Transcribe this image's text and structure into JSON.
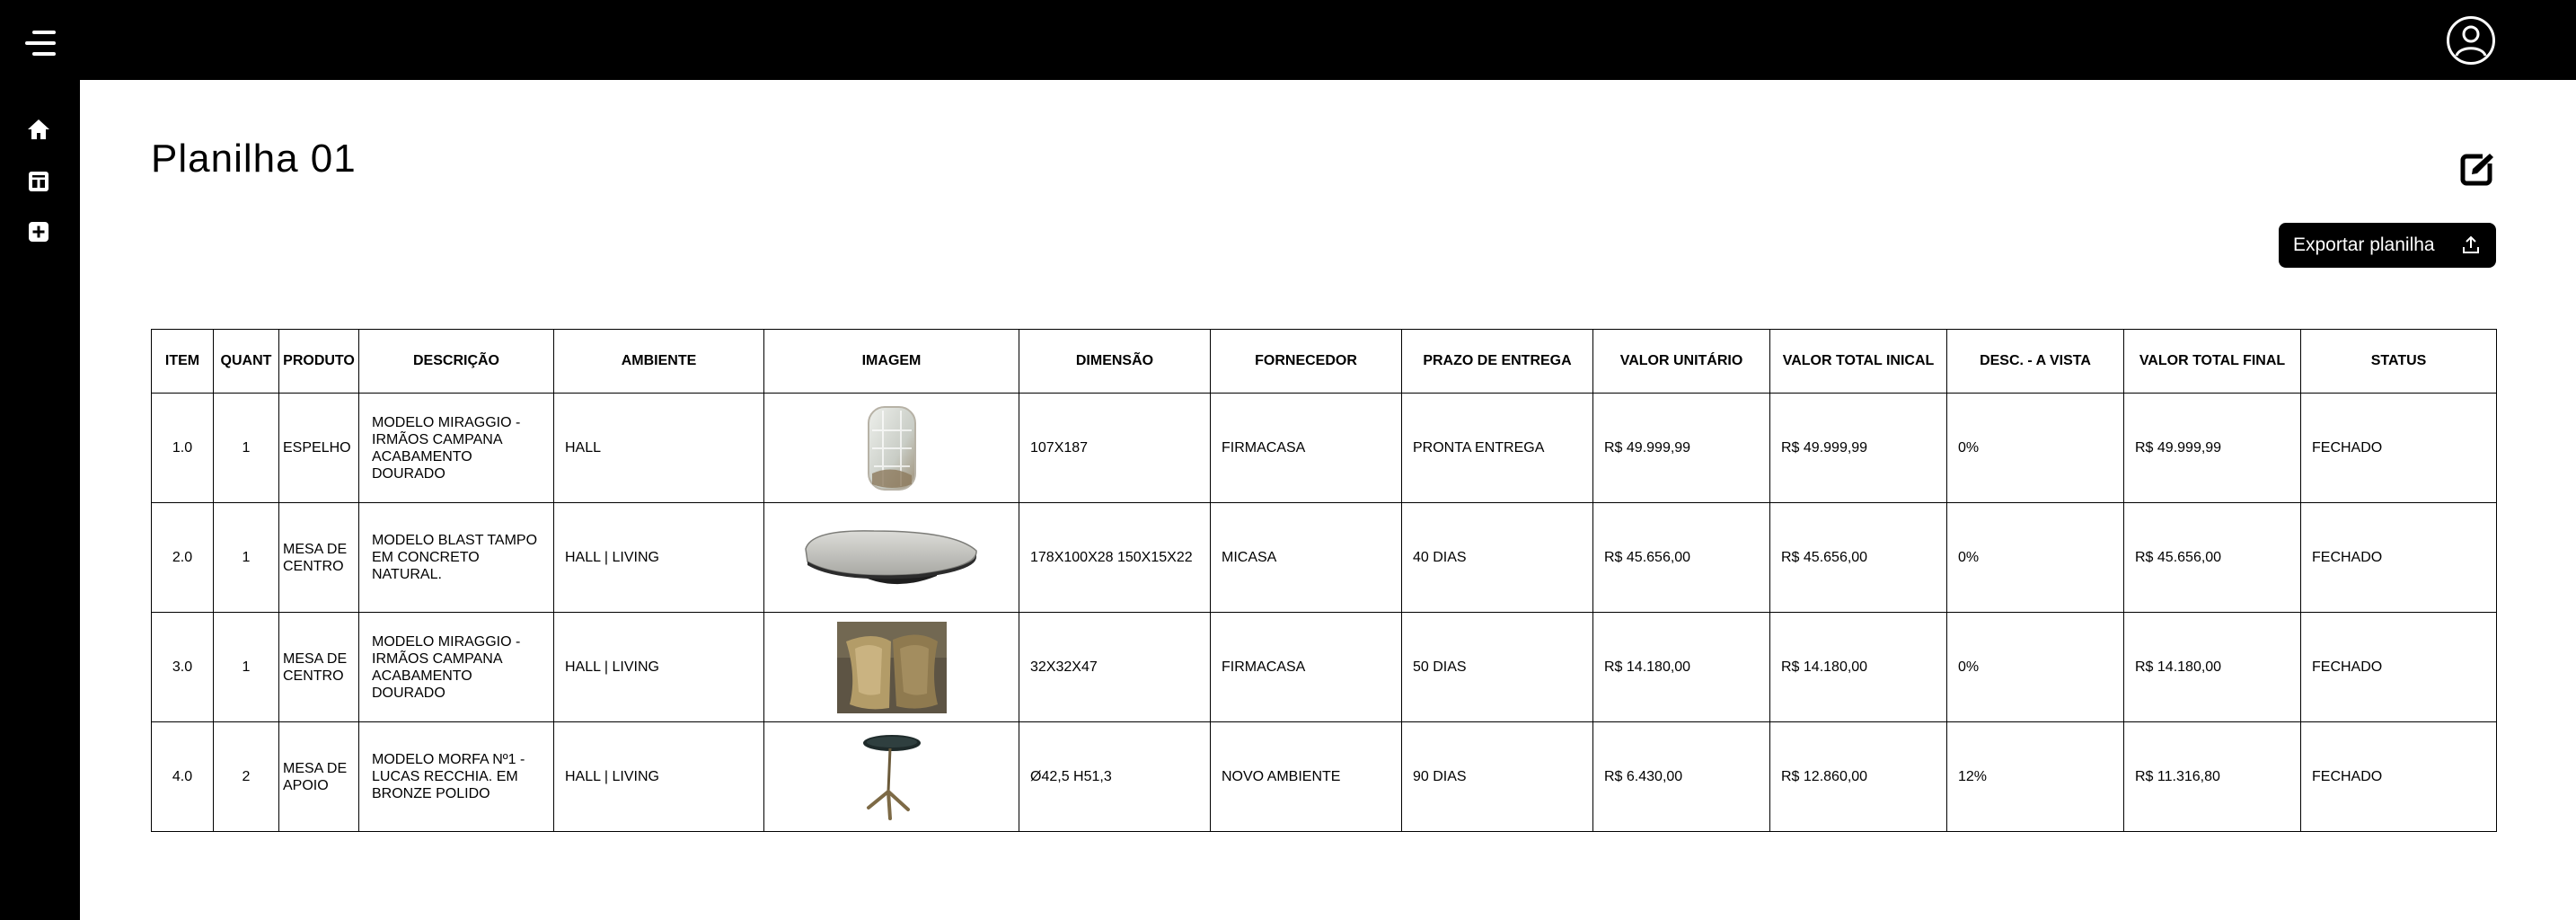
{
  "page": {
    "title": "Planilha 01",
    "export_label": "Exportar planilha"
  },
  "icons": {
    "menu": "menu-icon",
    "user": "user-avatar-icon",
    "home": "home-icon",
    "spreadsheet": "spreadsheet-icon",
    "add": "add-icon",
    "edit": "edit-icon",
    "upload": "upload-icon"
  },
  "colors": {
    "bar": "#000000",
    "background": "#ffffff",
    "text": "#000000"
  },
  "table": {
    "headers": [
      "ITEM",
      "QUANT",
      "PRODUTO",
      "DESCRIÇÃO",
      "AMBIENTE",
      "IMAGEM",
      "DIMENSÃO",
      "FORNECEDOR",
      "PRAZO DE ENTREGA",
      "VALOR UNITÁRIO",
      "VALOR TOTAL INICAL",
      "DESC. - A VISTA",
      "VALOR TOTAL FINAL",
      "STATUS"
    ],
    "rows": [
      {
        "item": "1.0",
        "quant": "1",
        "produto": "ESPELHO",
        "descricao": "MODELO MIRAGGIO - IRMÃOS CAMPANA ACABAMENTO DOURADO",
        "ambiente": "HALL",
        "imagem": "mirror-image",
        "dimensao": "107X187",
        "fornecedor": "FIRMACASA",
        "prazo": "PRONTA ENTREGA",
        "valor_unitario": "R$ 49.999,99",
        "valor_total_inicial": "R$ 49.999,99",
        "desconto": "0%",
        "valor_total_final": "R$ 49.999,99",
        "status": "FECHADO"
      },
      {
        "item": "2.0",
        "quant": "1",
        "produto": "MESA DE CENTRO",
        "descricao": "MODELO BLAST TAMPO EM CONCRETO NATURAL.",
        "ambiente": "HALL | LIVING",
        "imagem": "coffee-table-image",
        "dimensao": "178X100X28 150X15X22",
        "fornecedor": "MICASA",
        "prazo": "40 DIAS",
        "valor_unitario": "R$ 45.656,00",
        "valor_total_inicial": "R$ 45.656,00",
        "desconto": "0%",
        "valor_total_final": "R$ 45.656,00",
        "status": "FECHADO"
      },
      {
        "item": "3.0",
        "quant": "1",
        "produto": "MESA DE CENTRO",
        "descricao": "MODELO MIRAGGIO - IRMÃOS CAMPANA ACABAMENTO DOURADO",
        "ambiente": "HALL | LIVING",
        "imagem": "bronze-table-image",
        "dimensao": "32X32X47",
        "fornecedor": "FIRMACASA",
        "prazo": "50 DIAS",
        "valor_unitario": "R$ 14.180,00",
        "valor_total_inicial": "R$ 14.180,00",
        "desconto": "0%",
        "valor_total_final": "R$ 14.180,00",
        "status": "FECHADO"
      },
      {
        "item": "4.0",
        "quant": "2",
        "produto": "MESA DE APOIO",
        "descricao": "MODELO MORFA Nº1 - LUCAS RECCHIA. EM BRONZE POLIDO",
        "ambiente": "HALL | LIVING",
        "imagem": "side-table-image",
        "dimensao": "Ø42,5 H51,3",
        "fornecedor": "NOVO AMBIENTE",
        "prazo": "90 DIAS",
        "valor_unitario": "R$ 6.430,00",
        "valor_total_inicial": "R$ 12.860,00",
        "desconto": "12%",
        "valor_total_final": "R$ 11.316,80",
        "status": "FECHADO"
      }
    ]
  }
}
